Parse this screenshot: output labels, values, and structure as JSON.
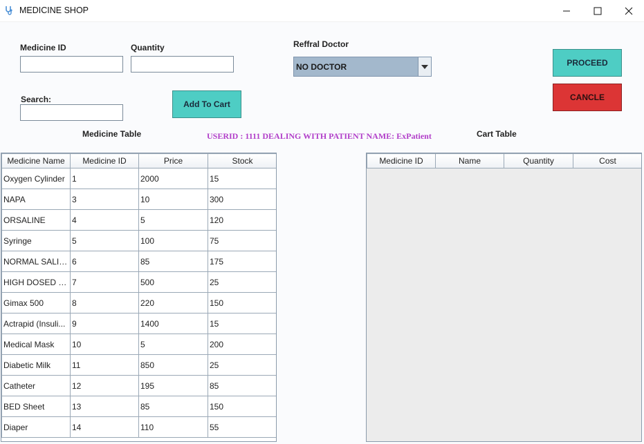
{
  "window": {
    "title": "MEDICINE SHOP",
    "icon": "stethoscope-icon"
  },
  "form": {
    "medicine_id_label": "Medicine ID",
    "medicine_id_value": "",
    "quantity_label": "Quantity",
    "quantity_value": "",
    "search_label": "Search:",
    "search_value": "",
    "add_to_cart_label": "Add To Cart",
    "doctor_label": "Reffral Doctor",
    "doctor_selected": "NO DOCTOR",
    "proceed_label": "PROCEED",
    "cancel_label": "CANCLE"
  },
  "colors": {
    "teal_button": "#4ecdc4",
    "red_button": "#dc3535",
    "user_text": "#b13ec9",
    "combo_bg": "#a3b8cc"
  },
  "user_info": "USERID : 1111 DEALING WITH PATIENT NAME: ExPatient",
  "medicine_table": {
    "title": "Medicine Table",
    "columns": [
      "Medicine Name",
      "Medicine ID",
      "Price",
      "Stock"
    ],
    "rows": [
      [
        "Oxygen Cylinder",
        "1",
        "2000",
        "15"
      ],
      [
        "NAPA",
        "3",
        "10",
        "300"
      ],
      [
        "ORSALINE",
        "4",
        "5",
        "120"
      ],
      [
        "Syringe",
        "5",
        "100",
        "75"
      ],
      [
        "NORMAL SALINE",
        "6",
        "85",
        "175"
      ],
      [
        "HIGH DOSED S...",
        "7",
        "500",
        "25"
      ],
      [
        "Gimax 500",
        "8",
        "220",
        "150"
      ],
      [
        "Actrapid (Insuli...",
        "9",
        "1400",
        "15"
      ],
      [
        "Medical Mask",
        "10",
        "5",
        "200"
      ],
      [
        "Diabetic Milk",
        "11",
        "850",
        "25"
      ],
      [
        "Catheter",
        "12",
        "195",
        "85"
      ],
      [
        "BED Sheet",
        "13",
        "85",
        "150"
      ],
      [
        "Diaper",
        "14",
        "110",
        "55"
      ]
    ]
  },
  "cart_table": {
    "title": "Cart Table",
    "columns": [
      "Medicine ID",
      "Name",
      "Quantity",
      "Cost"
    ],
    "rows": []
  }
}
